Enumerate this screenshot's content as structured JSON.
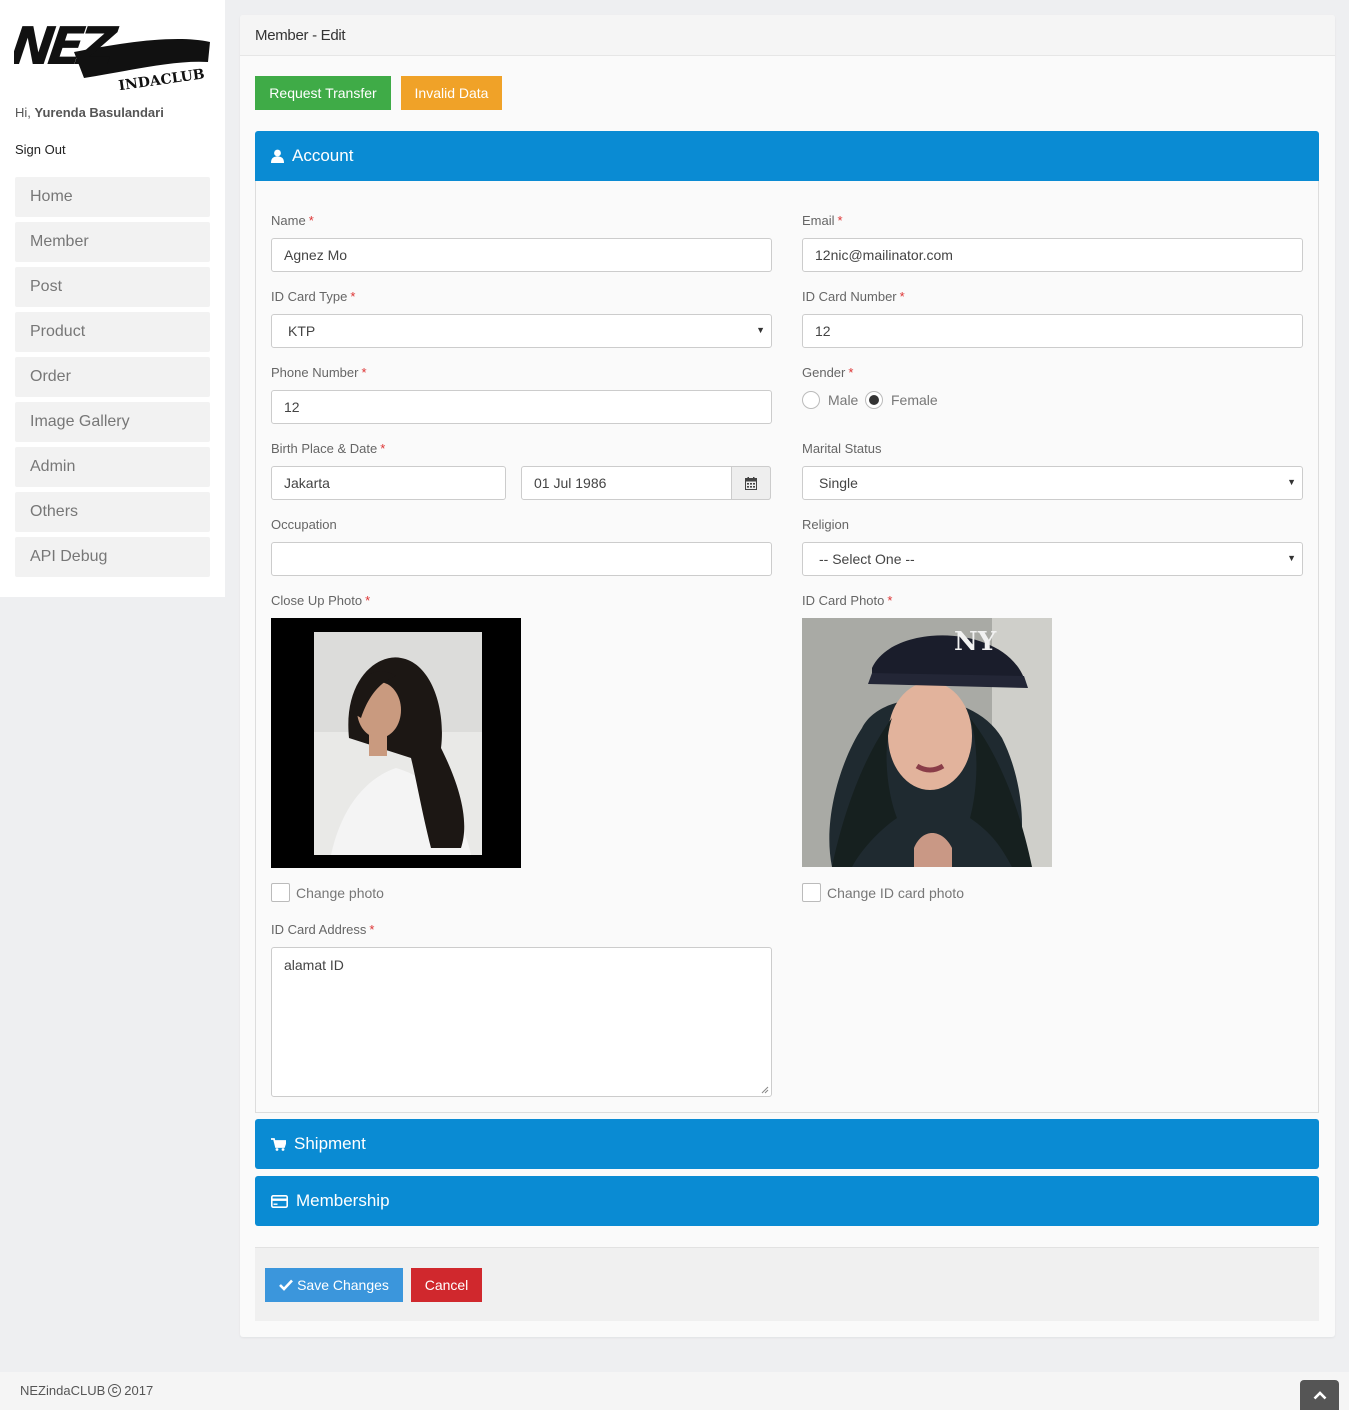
{
  "brand": {
    "logo_text": "NEZ",
    "logo_subtext": "INDACLUB"
  },
  "user": {
    "greeting_prefix": "Hi,",
    "name": "Yurenda Basulandari",
    "signout_label": "Sign Out"
  },
  "sidebar": {
    "items": [
      {
        "label": "Home"
      },
      {
        "label": "Member"
      },
      {
        "label": "Post"
      },
      {
        "label": "Product"
      },
      {
        "label": "Order"
      },
      {
        "label": "Image Gallery"
      },
      {
        "label": "Admin"
      },
      {
        "label": "Others"
      },
      {
        "label": "API Debug"
      }
    ]
  },
  "page": {
    "title": "Member - Edit"
  },
  "actions": {
    "request_transfer": "Request Transfer",
    "invalid_data": "Invalid Data"
  },
  "panels": {
    "account": "Account",
    "shipment": "Shipment",
    "membership": "Membership"
  },
  "form": {
    "name": {
      "label": "Name",
      "value": "Agnez Mo"
    },
    "email": {
      "label": "Email",
      "value": "12nic@mailinator.com"
    },
    "id_card_type": {
      "label": "ID Card Type",
      "value": "KTP"
    },
    "id_card_number": {
      "label": "ID Card Number",
      "value": "12"
    },
    "phone_number": {
      "label": "Phone Number",
      "value": "12"
    },
    "gender": {
      "label": "Gender",
      "options": [
        "Male",
        "Female"
      ],
      "selected": "Female"
    },
    "birth": {
      "label": "Birth Place & Date",
      "place": "Jakarta",
      "date": "01 Jul 1986"
    },
    "marital_status": {
      "label": "Marital Status",
      "value": "Single"
    },
    "occupation": {
      "label": "Occupation",
      "value": ""
    },
    "religion": {
      "label": "Religion",
      "value": "-- Select One --"
    },
    "close_up_photo": {
      "label": "Close Up Photo",
      "change_label": "Change photo"
    },
    "id_card_photo": {
      "label": "ID Card Photo",
      "change_label": "Change ID card photo"
    },
    "id_card_address": {
      "label": "ID Card Address",
      "value": "alamat ID"
    },
    "required_mark": "*"
  },
  "buttons": {
    "save": "Save Changes",
    "cancel": "Cancel"
  },
  "footer": {
    "brand": "NEZindaCLUB",
    "copyright_symbol": "C",
    "year": "2017"
  },
  "colors": {
    "primary": "#0a8bd3",
    "success": "#3fab47",
    "warning": "#f0a228",
    "danger": "#d0282d",
    "save": "#3b96dc"
  }
}
